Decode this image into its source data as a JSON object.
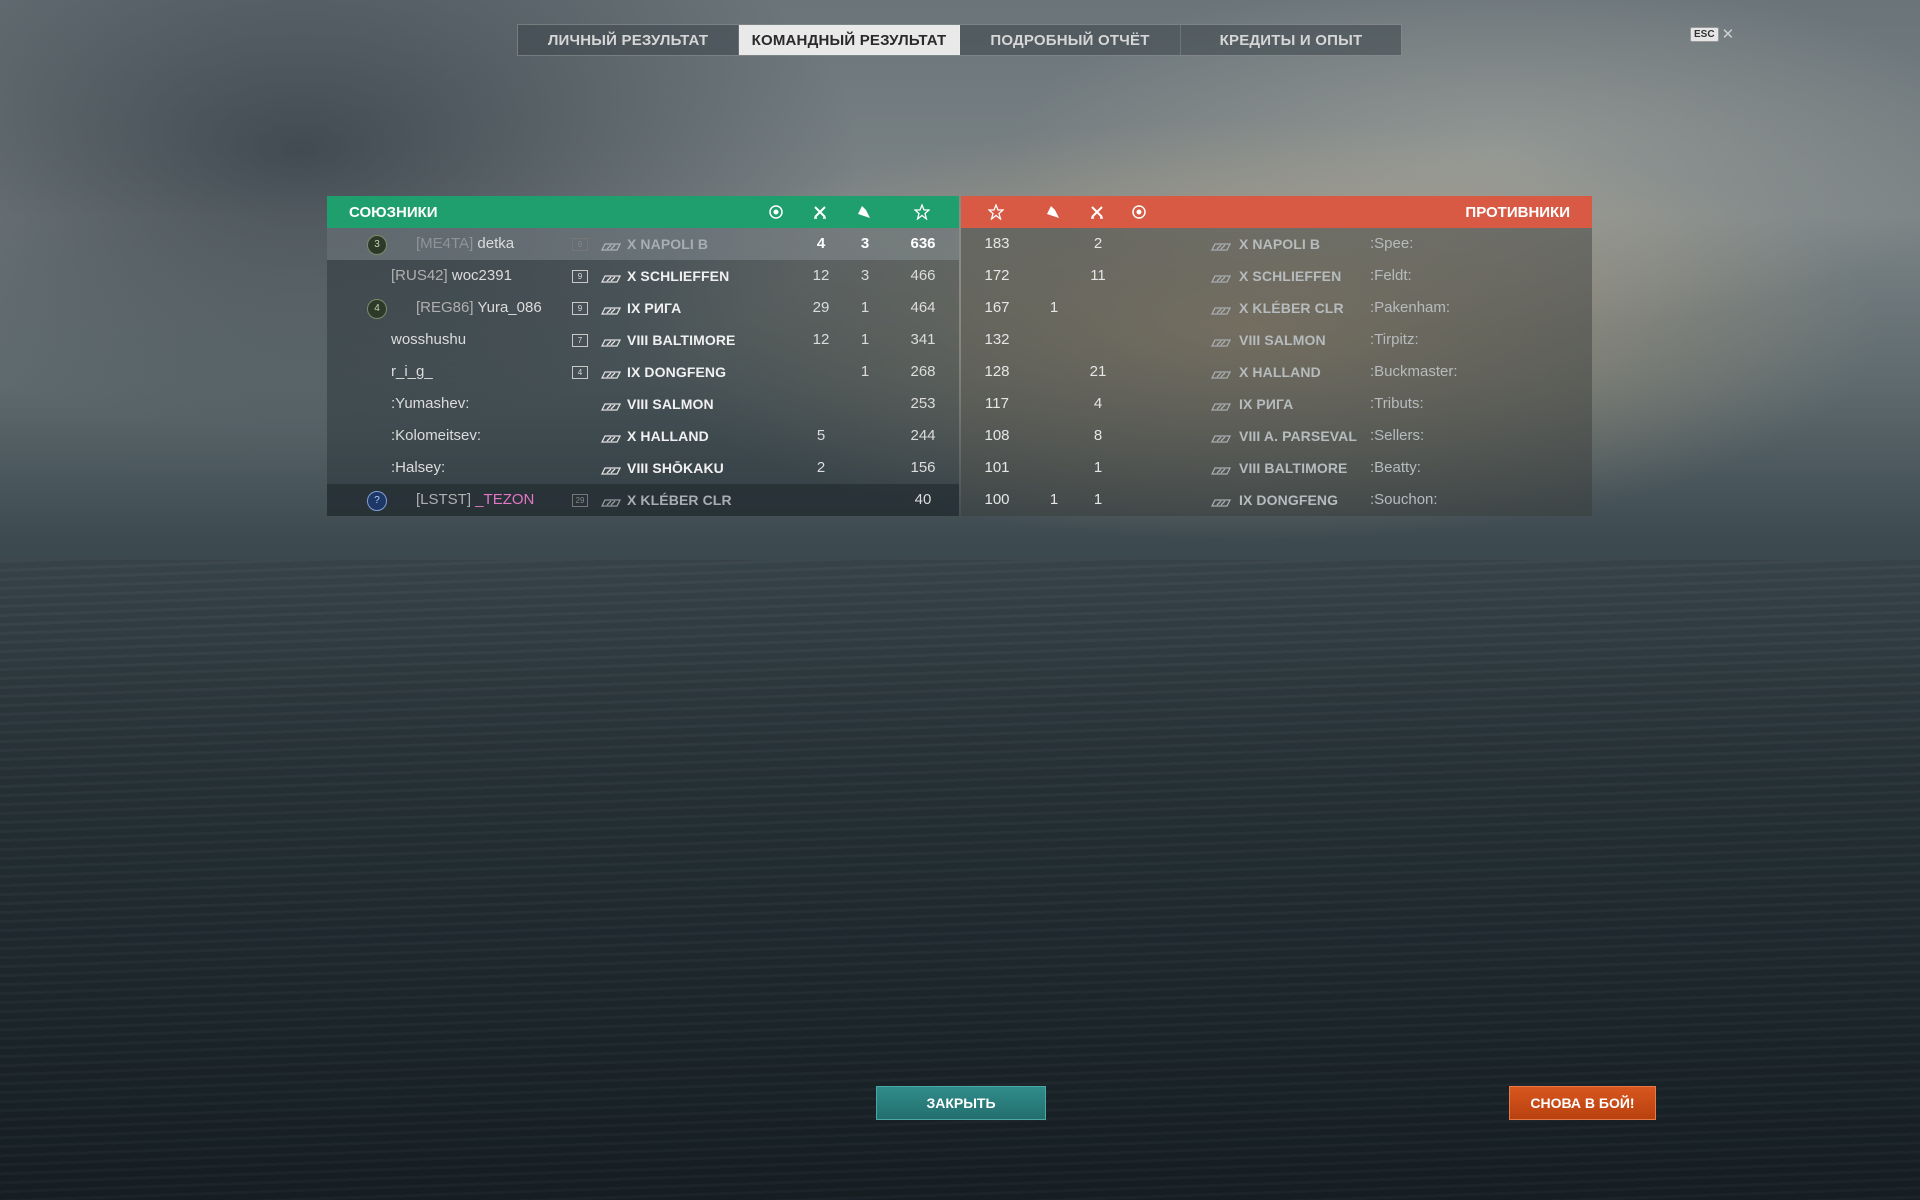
{
  "tabs": [
    {
      "label": "ЛИЧНЫЙ РЕЗУЛЬТАТ",
      "active": false
    },
    {
      "label": "КОМАНДНЫЙ РЕЗУЛЬТАТ",
      "active": true
    },
    {
      "label": "ПОДРОБНЫЙ ОТЧЁТ",
      "active": false
    },
    {
      "label": "КРЕДИТЫ И ОПЫТ",
      "active": false
    }
  ],
  "esc": {
    "key": "ESC",
    "close": "✕"
  },
  "allies": {
    "title": "СОЮЗНИКИ",
    "rows": [
      {
        "rank": "3",
        "clan": "[ME4TA]",
        "name": "detka",
        "div": "9",
        "ship": "X NAPOLI B",
        "kills": "4",
        "planes": "3",
        "xp": "636"
      },
      {
        "rank": "",
        "clan": "[RUS42]",
        "name": "woc2391",
        "div": "9",
        "ship": "X SCHLIEFFEN",
        "kills": "12",
        "planes": "3",
        "xp": "466"
      },
      {
        "rank": "4",
        "clan": "[REG86]",
        "name": "Yura_086",
        "div": "9",
        "ship": "IX РИГА",
        "kills": "29",
        "planes": "1",
        "xp": "464"
      },
      {
        "rank": "",
        "clan": "",
        "name": "wosshushu",
        "div": "7",
        "ship": "VIII BALTIMORE",
        "kills": "12",
        "planes": "1",
        "xp": "341"
      },
      {
        "rank": "",
        "clan": "",
        "name": "r_i_g_",
        "div": "4",
        "ship": "IX DONGFENG",
        "kills": "",
        "planes": "1",
        "xp": "268"
      },
      {
        "rank": "",
        "clan": "",
        "name": ":Yumashev:",
        "div": "",
        "ship": "VIII SALMON",
        "kills": "",
        "planes": "",
        "xp": "253"
      },
      {
        "rank": "",
        "clan": "",
        "name": ":Kolomeitsev:",
        "div": "",
        "ship": "X HALLAND",
        "kills": "5",
        "planes": "",
        "xp": "244"
      },
      {
        "rank": "",
        "clan": "",
        "name": ":Halsey:",
        "div": "",
        "ship": "VIII SHŌKAKU",
        "kills": "2",
        "planes": "",
        "xp": "156"
      },
      {
        "rank": "?",
        "clan": "[LSTST]",
        "name": "_TEZON",
        "div": "29",
        "ship": "X KLÉBER CLR",
        "kills": "",
        "planes": "",
        "xp": "40"
      }
    ]
  },
  "enemies": {
    "title": "ПРОТИВНИКИ",
    "rows": [
      {
        "xp": "183",
        "planes": "",
        "kills": "2",
        "ship": "X NAPOLI B",
        "name": ":Spee:"
      },
      {
        "xp": "172",
        "planes": "",
        "kills": "11",
        "ship": "X SCHLIEFFEN",
        "name": ":Feldt:"
      },
      {
        "xp": "167",
        "planes": "1",
        "kills": "",
        "ship": "X KLÉBER CLR",
        "name": ":Pakenham:"
      },
      {
        "xp": "132",
        "planes": "",
        "kills": "",
        "ship": "VIII SALMON",
        "name": ":Tirpitz:"
      },
      {
        "xp": "128",
        "planes": "",
        "kills": "21",
        "ship": "X HALLAND",
        "name": ":Buckmaster:"
      },
      {
        "xp": "117",
        "planes": "",
        "kills": "4",
        "ship": "IX РИГА",
        "name": ":Tributs:"
      },
      {
        "xp": "108",
        "planes": "",
        "kills": "8",
        "ship": "VIII A. PARSEVAL",
        "name": ":Sellers:"
      },
      {
        "xp": "101",
        "planes": "",
        "kills": "1",
        "ship": "VIII BALTIMORE",
        "name": ":Beatty:"
      },
      {
        "xp": "100",
        "planes": "1",
        "kills": "1",
        "ship": "IX DONGFENG",
        "name": ":Souchon:"
      }
    ]
  },
  "buttons": {
    "close": "ЗАКРЫТЬ",
    "again": "СНОВА В БОЙ!"
  },
  "colors": {
    "allies": "#1f9e6e",
    "enemies": "#d85a45",
    "close_button": "#2a7e7c",
    "again_button": "#c94a16"
  }
}
